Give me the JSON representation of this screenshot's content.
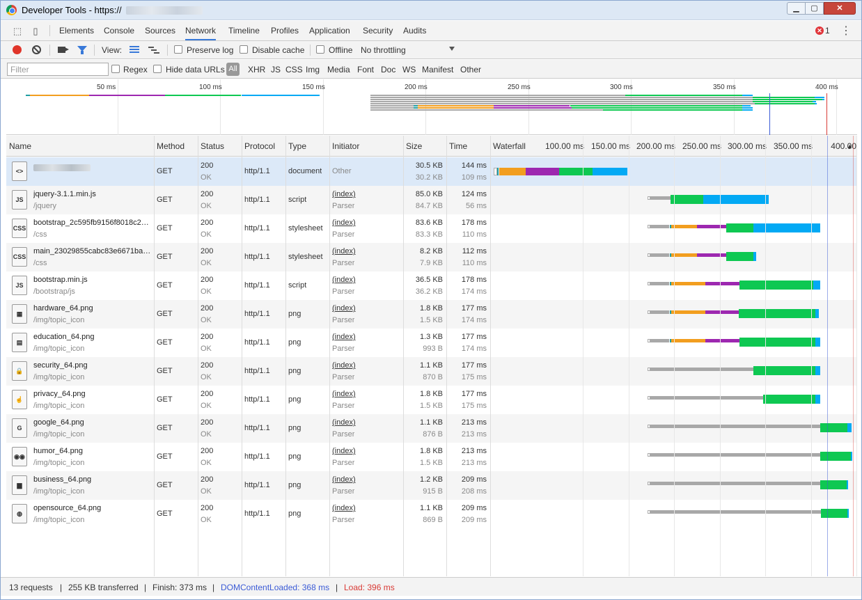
{
  "window": {
    "title": "Developer Tools - https://",
    "controls": {
      "minimize": "▁",
      "maximize": "▢",
      "close": "✕"
    }
  },
  "tabs": [
    "Elements",
    "Console",
    "Sources",
    "Network",
    "Timeline",
    "Profiles",
    "Application",
    "Security",
    "Audits"
  ],
  "active_tab": "Network",
  "errors": {
    "count": "1",
    "icon_glyph": "✕"
  },
  "toolbar": {
    "view_label": "View:",
    "preserve_log": "Preserve log",
    "disable_cache": "Disable cache",
    "offline": "Offline",
    "throttling": "No throttling"
  },
  "filterbar": {
    "placeholder": "Filter",
    "regex": "Regex",
    "hide_data_urls": "Hide data URLs",
    "types": [
      "All",
      "XHR",
      "JS",
      "CSS",
      "Img",
      "Media",
      "Font",
      "Doc",
      "WS",
      "Manifest",
      "Other"
    ]
  },
  "overview": {
    "ticks": [
      "50 ms",
      "100 ms",
      "150 ms",
      "200 ms",
      "250 ms",
      "300 ms",
      "350 ms",
      "400 ms"
    ]
  },
  "columns": [
    "Name",
    "Method",
    "Status",
    "Protocol",
    "Type",
    "Initiator",
    "Size",
    "Time",
    "Waterfall"
  ],
  "waterfall_ticks": [
    "100.00 ms",
    "150.00 ms",
    "200.00 ms",
    "250.00 ms",
    "300.00 ms",
    "350.00 ms",
    "400.00"
  ],
  "sort_glyph": "▲",
  "timing_colors": {
    "queued": "#ffffff",
    "stalled": "#a8a8a8",
    "dns": "#1f9ea3",
    "connect": "#f29e1f",
    "ssl": "#9d28b0",
    "waiting": "#0ec852",
    "download": "#03a9f4",
    "domcontentloaded": "#3b5bd6",
    "load": "#d93a35"
  },
  "requests": [
    {
      "name": "",
      "path": "",
      "icon": "document-icon",
      "icon_text": "<>",
      "method": "GET",
      "status": "200",
      "status_text": "OK",
      "protocol": "http/1.1",
      "type": "document",
      "initiator": "Other",
      "initiator_sub": "",
      "size": "30.5 KB",
      "size_sub": "30.2 KB",
      "time": "144 ms",
      "latency": "109 ms",
      "timing": [
        [
          "queued",
          2,
          6
        ],
        [
          "dns",
          6,
          8
        ],
        [
          "connect",
          8,
          37
        ],
        [
          "ssl",
          37,
          74
        ],
        [
          "waiting",
          74,
          111
        ],
        [
          "download",
          111,
          149
        ]
      ]
    },
    {
      "name": "jquery-3.1.1.min.js",
      "path": "/jquery",
      "icon": "script-icon",
      "icon_text": "JS",
      "method": "GET",
      "status": "200",
      "status_text": "OK",
      "protocol": "http/1.1",
      "type": "script",
      "initiator": "(index)",
      "initiator_sub": "Parser",
      "size": "85.0 KB",
      "size_sub": "84.7 KB",
      "time": "124 ms",
      "latency": "56 ms",
      "timing": [
        [
          "queued",
          171,
          174
        ],
        [
          "stalled",
          174,
          196
        ],
        [
          "waiting",
          196,
          232
        ],
        [
          "download",
          232,
          304
        ]
      ]
    },
    {
      "name": "bootstrap_2c595fb9156f8018c27…",
      "path": "/css",
      "icon": "stylesheet-icon",
      "icon_text": "CSS",
      "method": "GET",
      "status": "200",
      "status_text": "OK",
      "protocol": "http/1.1",
      "type": "stylesheet",
      "initiator": "(index)",
      "initiator_sub": "Parser",
      "size": "83.6 KB",
      "size_sub": "83.3 KB",
      "time": "178 ms",
      "latency": "110 ms",
      "timing": [
        [
          "queued",
          171,
          174
        ],
        [
          "stalled",
          174,
          195
        ],
        [
          "dns",
          195,
          197
        ],
        [
          "connect",
          197,
          225
        ],
        [
          "ssl",
          225,
          257
        ],
        [
          "waiting",
          257,
          287
        ],
        [
          "download",
          287,
          360
        ]
      ]
    },
    {
      "name": "main_23029855cabc83e6671ba1…",
      "path": "/css",
      "icon": "stylesheet-icon",
      "icon_text": "CSS",
      "method": "GET",
      "status": "200",
      "status_text": "OK",
      "protocol": "http/1.1",
      "type": "stylesheet",
      "initiator": "(index)",
      "initiator_sub": "Parser",
      "size": "8.2 KB",
      "size_sub": "7.9 KB",
      "time": "112 ms",
      "latency": "110 ms",
      "timing": [
        [
          "queued",
          171,
          174
        ],
        [
          "stalled",
          174,
          195
        ],
        [
          "dns",
          195,
          197
        ],
        [
          "connect",
          197,
          225
        ],
        [
          "ssl",
          225,
          257
        ],
        [
          "waiting",
          257,
          287
        ],
        [
          "download",
          287,
          290
        ]
      ]
    },
    {
      "name": "bootstrap.min.js",
      "path": "/bootstrap/js",
      "icon": "script-icon",
      "icon_text": "JS",
      "method": "GET",
      "status": "200",
      "status_text": "OK",
      "protocol": "http/1.1",
      "type": "script",
      "initiator": "(index)",
      "initiator_sub": "Parser",
      "size": "36.5 KB",
      "size_sub": "36.2 KB",
      "time": "178 ms",
      "latency": "174 ms",
      "timing": [
        [
          "queued",
          171,
          174
        ],
        [
          "stalled",
          174,
          195
        ],
        [
          "dns",
          195,
          197
        ],
        [
          "connect",
          197,
          234
        ],
        [
          "ssl",
          234,
          272
        ],
        [
          "waiting",
          272,
          353
        ],
        [
          "download",
          353,
          360
        ]
      ]
    },
    {
      "name": "hardware_64.png",
      "path": "/img/topic_icon",
      "icon": "image-icon",
      "icon_text": "▦",
      "method": "GET",
      "status": "200",
      "status_text": "OK",
      "protocol": "http/1.1",
      "type": "png",
      "initiator": "(index)",
      "initiator_sub": "Parser",
      "size": "1.8 KB",
      "size_sub": "1.5 KB",
      "time": "177 ms",
      "latency": "174 ms",
      "timing": [
        [
          "queued",
          171,
          174
        ],
        [
          "stalled",
          174,
          195
        ],
        [
          "dns",
          195,
          197
        ],
        [
          "connect",
          197,
          234
        ],
        [
          "ssl",
          234,
          271
        ],
        [
          "waiting",
          271,
          355
        ],
        [
          "download",
          355,
          359
        ]
      ]
    },
    {
      "name": "education_64.png",
      "path": "/img/topic_icon",
      "icon": "image-icon",
      "icon_text": "▤",
      "method": "GET",
      "status": "200",
      "status_text": "OK",
      "protocol": "http/1.1",
      "type": "png",
      "initiator": "(index)",
      "initiator_sub": "Parser",
      "size": "1.3 KB",
      "size_sub": "993 B",
      "time": "177 ms",
      "latency": "174 ms",
      "timing": [
        [
          "queued",
          171,
          174
        ],
        [
          "stalled",
          174,
          195
        ],
        [
          "dns",
          195,
          197
        ],
        [
          "connect",
          197,
          234
        ],
        [
          "ssl",
          234,
          272
        ],
        [
          "waiting",
          272,
          355
        ],
        [
          "download",
          355,
          360
        ]
      ]
    },
    {
      "name": "security_64.png",
      "path": "/img/topic_icon",
      "icon": "lock-icon",
      "icon_text": "🔒",
      "method": "GET",
      "status": "200",
      "status_text": "OK",
      "protocol": "http/1.1",
      "type": "png",
      "initiator": "(index)",
      "initiator_sub": "Parser",
      "size": "1.1 KB",
      "size_sub": "870 B",
      "time": "177 ms",
      "latency": "175 ms",
      "timing": [
        [
          "queued",
          171,
          174
        ],
        [
          "stalled",
          174,
          287
        ],
        [
          "waiting",
          287,
          355
        ],
        [
          "download",
          355,
          360
        ]
      ]
    },
    {
      "name": "privacy_64.png",
      "path": "/img/topic_icon",
      "icon": "hand-icon",
      "icon_text": "☝",
      "method": "GET",
      "status": "200",
      "status_text": "OK",
      "protocol": "http/1.1",
      "type": "png",
      "initiator": "(index)",
      "initiator_sub": "Parser",
      "size": "1.8 KB",
      "size_sub": "1.5 KB",
      "time": "177 ms",
      "latency": "175 ms",
      "timing": [
        [
          "queued",
          171,
          174
        ],
        [
          "stalled",
          174,
          298
        ],
        [
          "waiting",
          298,
          355
        ],
        [
          "download",
          355,
          360
        ]
      ]
    },
    {
      "name": "google_64.png",
      "path": "/img/topic_icon",
      "icon": "google-icon",
      "icon_text": "G",
      "method": "GET",
      "status": "200",
      "status_text": "OK",
      "protocol": "http/1.1",
      "type": "png",
      "initiator": "(index)",
      "initiator_sub": "Parser",
      "size": "1.1 KB",
      "size_sub": "876 B",
      "time": "213 ms",
      "latency": "213 ms",
      "timing": [
        [
          "queued",
          171,
          174
        ],
        [
          "stalled",
          174,
          360
        ],
        [
          "waiting",
          360,
          390
        ],
        [
          "download",
          390,
          395
        ]
      ]
    },
    {
      "name": "humor_64.png",
      "path": "/img/topic_icon",
      "icon": "glasses-icon",
      "icon_text": "◉◉",
      "method": "GET",
      "status": "200",
      "status_text": "OK",
      "protocol": "http/1.1",
      "type": "png",
      "initiator": "(index)",
      "initiator_sub": "Parser",
      "size": "1.8 KB",
      "size_sub": "1.5 KB",
      "time": "213 ms",
      "latency": "213 ms",
      "timing": [
        [
          "queued",
          171,
          174
        ],
        [
          "stalled",
          174,
          360
        ],
        [
          "waiting",
          360,
          394
        ],
        [
          "download",
          394,
          395
        ]
      ]
    },
    {
      "name": "business_64.png",
      "path": "/img/topic_icon",
      "icon": "briefcase-icon",
      "icon_text": "▆",
      "method": "GET",
      "status": "200",
      "status_text": "OK",
      "protocol": "http/1.1",
      "type": "png",
      "initiator": "(index)",
      "initiator_sub": "Parser",
      "size": "1.2 KB",
      "size_sub": "915 B",
      "time": "209 ms",
      "latency": "208 ms",
      "timing": [
        [
          "queued",
          171,
          174
        ],
        [
          "stalled",
          174,
          360
        ],
        [
          "waiting",
          360,
          389
        ],
        [
          "download",
          389,
          391
        ]
      ]
    },
    {
      "name": "opensource_64.png",
      "path": "/img/topic_icon",
      "icon": "opensource-icon",
      "icon_text": "◍",
      "method": "GET",
      "status": "200",
      "status_text": "OK",
      "protocol": "http/1.1",
      "type": "png",
      "initiator": "(index)",
      "initiator_sub": "Parser",
      "size": "1.1 KB",
      "size_sub": "869 B",
      "time": "209 ms",
      "latency": "209 ms",
      "timing": [
        [
          "queued",
          171,
          174
        ],
        [
          "stalled",
          174,
          361
        ],
        [
          "waiting",
          361,
          390
        ],
        [
          "download",
          390,
          391
        ]
      ]
    }
  ],
  "status": {
    "requests": "13 requests",
    "transferred": "255 KB transferred",
    "finish": "Finish: 373 ms",
    "domcontentloaded": "DOMContentLoaded: 368 ms",
    "load": "Load: 396 ms",
    "separator": "|"
  }
}
